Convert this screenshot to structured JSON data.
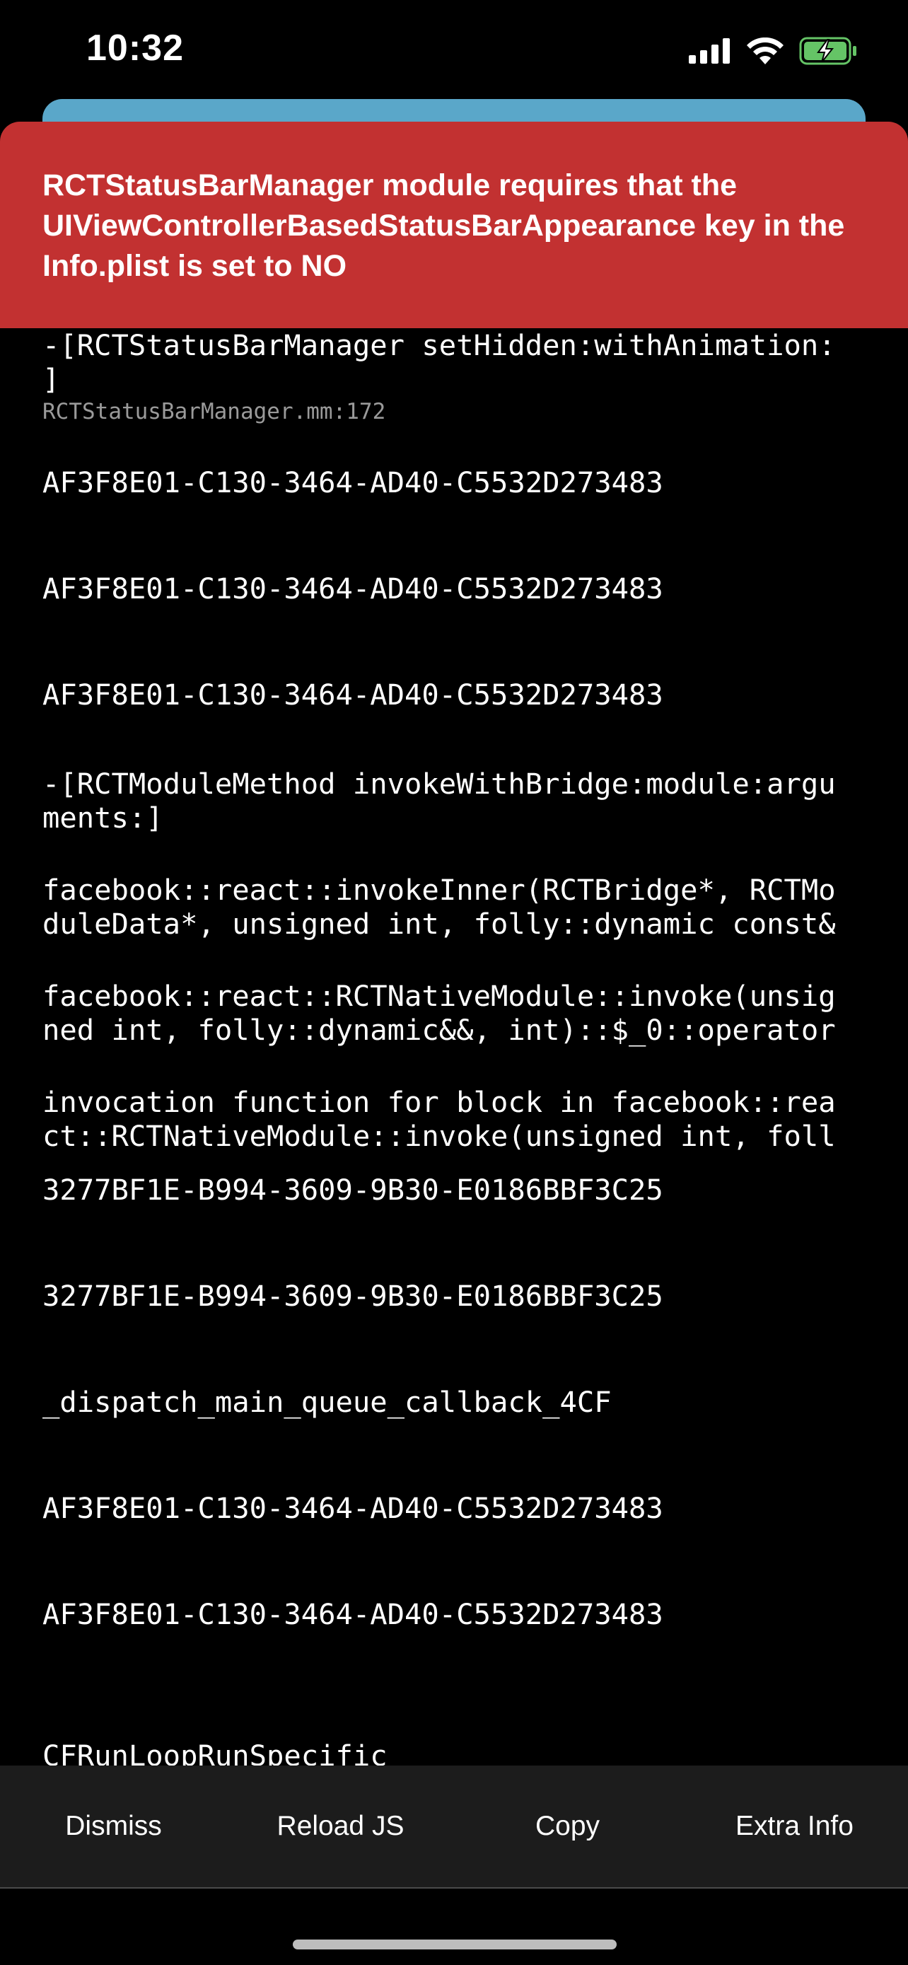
{
  "status_bar": {
    "time": "10:32",
    "icons": [
      "cellular-signal-icon",
      "wifi-icon",
      "battery-charging-icon"
    ],
    "battery_color": "#65c466"
  },
  "colors": {
    "error_red": "#c23131",
    "banner_teal": "#5aa7c9",
    "toolbar_bg": "#1c1c1c"
  },
  "error": {
    "message": "RCTStatusBarManager module requires that the UIViewControllerBasedStatusBarAppearance key in the Info.plist is set to NO"
  },
  "stack_frames": [
    {
      "method": "-[RCTStatusBarManager setHidden:withAnimation:\n]",
      "file": "RCTStatusBarManager.mm:172"
    },
    {
      "method": "AF3F8E01-C130-3464-AD40-C5532D273483",
      "file": ""
    },
    {
      "method": "AF3F8E01-C130-3464-AD40-C5532D273483",
      "file": ""
    },
    {
      "method": "AF3F8E01-C130-3464-AD40-C5532D273483",
      "file": ""
    },
    {
      "method": "-[RCTModuleMethod invokeWithBridge:module:argu\nments:]",
      "file": ""
    },
    {
      "method": "facebook::react::invokeInner(RCTBridge*, RCTMo\nduleData*, unsigned int, folly::dynamic const&",
      "file": ""
    },
    {
      "method": "facebook::react::RCTNativeModule::invoke(unsig\nned int, folly::dynamic&&, int)::$_0::operator",
      "file": ""
    },
    {
      "method": "invocation function for block in facebook::rea\nct::RCTNativeModule::invoke(unsigned int, foll",
      "file": ""
    },
    {
      "method": "3277BF1E-B994-3609-9B30-E0186BBF3C25",
      "file": ""
    },
    {
      "method": "3277BF1E-B994-3609-9B30-E0186BBF3C25",
      "file": ""
    },
    {
      "method": "_dispatch_main_queue_callback_4CF",
      "file": ""
    },
    {
      "method": "AF3F8E01-C130-3464-AD40-C5532D273483",
      "file": ""
    },
    {
      "method": "AF3F8E01-C130-3464-AD40-C5532D273483",
      "file": ""
    },
    {
      "method": "CFRunLoopRunSpecific",
      "file": ""
    }
  ],
  "toolbar": {
    "dismiss_label": "Dismiss",
    "reload_label": "Reload JS",
    "copy_label": "Copy",
    "extra_info_label": "Extra Info"
  }
}
